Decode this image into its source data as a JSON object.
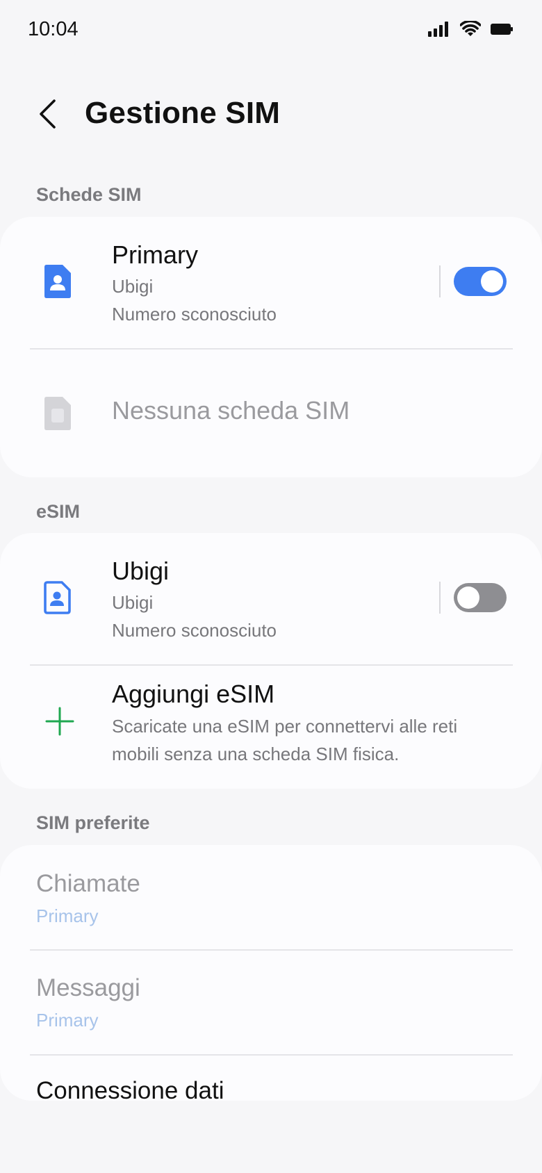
{
  "status_bar": {
    "time": "10:04",
    "icons": [
      "signal-icon",
      "wifi-icon",
      "battery-icon"
    ]
  },
  "header": {
    "title": "Gestione SIM",
    "back_icon": "chevron-left-icon"
  },
  "sections": {
    "sim_cards": {
      "label": "Schede SIM",
      "primary": {
        "title": "Primary",
        "carrier": "Ubigi",
        "number": "Numero sconosciuto",
        "enabled": true
      },
      "empty_slot": {
        "title": "Nessuna scheda SIM"
      }
    },
    "esim": {
      "label": "eSIM",
      "ubigi": {
        "title": "Ubigi",
        "carrier": "Ubigi",
        "number": "Numero sconosciuto",
        "enabled": false
      },
      "add": {
        "title": "Aggiungi eSIM",
        "description_line1": "Scaricate una eSIM per connettervi alle reti",
        "description_line2": "mobili senza una scheda SIM fisica."
      }
    },
    "preferred": {
      "label": "SIM preferite",
      "calls": {
        "title": "Chiamate",
        "value": "Primary"
      },
      "messages": {
        "title": "Messaggi",
        "value": "Primary"
      },
      "data": {
        "title": "Connessione dati"
      }
    }
  },
  "colors": {
    "accent": "#3e7df1",
    "toggle_off": "#8e8e92",
    "add_icon": "#1fa750",
    "subvalue_disabled": "#a7c3ea",
    "background": "#f6f6f8",
    "card": "#fcfcfe"
  }
}
